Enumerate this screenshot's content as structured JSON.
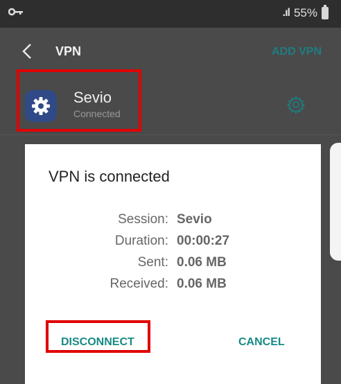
{
  "status_bar": {
    "signal": ".ıl",
    "battery_percent": "55%"
  },
  "app_bar": {
    "title": "VPN",
    "add_label": "ADD VPN"
  },
  "vpn_item": {
    "name": "Sevio",
    "status": "Connected"
  },
  "dialog": {
    "title": "VPN is connected",
    "rows": [
      {
        "label": "Session:",
        "value": "Sevio"
      },
      {
        "label": "Duration:",
        "value": "00:00:27"
      },
      {
        "label": "Sent:",
        "value": "0.06 MB"
      },
      {
        "label": "Received:",
        "value": "0.06 MB"
      }
    ],
    "disconnect_label": "DISCONNECT",
    "cancel_label": "CANCEL"
  },
  "colors": {
    "accent": "#178a84",
    "highlight": "#e00000",
    "app_icon": "#2f4a86"
  }
}
